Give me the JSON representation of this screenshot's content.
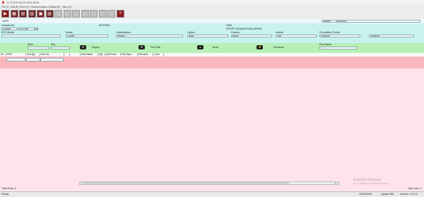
{
  "window": {
    "title": "A 'DSGR.MOA.BEN.BOB"
  },
  "menu": [
    "File (F)",
    "Edit (E)",
    "View (V)",
    "Communication (C)",
    "Data (D)",
    "Help (H)"
  ],
  "toolbar": {
    "buttons": [
      {
        "name": "exit-button",
        "glyph": "▶",
        "color": "#8b1a1a",
        "disabled": false
      },
      {
        "name": "open-button",
        "glyph": "▦",
        "color": "#7a2222",
        "disabled": false
      },
      {
        "name": "catalog-button",
        "glyph": "▤",
        "color": "#6b1f1f",
        "disabled": false
      },
      {
        "name": "print-button",
        "glyph": "▥",
        "color": "#702020",
        "disabled": false
      },
      {
        "name": "search-button",
        "glyph": "▣",
        "color": "#7b2323",
        "disabled": false
      },
      {
        "name": "list-button",
        "glyph": "▧",
        "color": "#6e1e1e",
        "disabled": false
      },
      {
        "name": "tool7-button",
        "glyph": "▢",
        "color": "#bdbdbd",
        "disabled": true
      },
      {
        "name": "tool8-button",
        "glyph": "▢",
        "color": "#bdbdbd",
        "disabled": true
      },
      {
        "name": "tool9-button",
        "glyph": "▢",
        "color": "#bdbdbd",
        "disabled": true
      },
      {
        "name": "tool10-button",
        "glyph": "▢",
        "color": "#bdbdbd",
        "disabled": true
      },
      {
        "name": "tool11-button",
        "glyph": "▢",
        "color": "#bdbdbd",
        "disabled": true
      },
      {
        "name": "tool12-button",
        "glyph": "▢",
        "color": "#bdbdbd",
        "disabled": true
      },
      {
        "name": "tool13-button",
        "glyph": "▢",
        "color": "#bdbdbd",
        "disabled": true
      },
      {
        "name": "help-button",
        "glyph": "?",
        "color": "#8b1a1a",
        "disabled": false
      }
    ]
  },
  "tabline": {
    "left": "CATS",
    "region": "JAPAN",
    "date": "2025/01/17"
  },
  "vehicle": {
    "chassis_label": "Chassis No",
    "chassis_prefix": "Z14AW",
    "chassis_value": "EZX 900",
    "model_name": "AIRTREK",
    "year": "2400",
    "description": "SPORT GEAR(HPW4D),SEPAT",
    "epc_label": "EPC Model",
    "epc_value": "",
    "model_label": "Model",
    "model_value": "CU4W",
    "class_label": "Classification",
    "class_value": "XRME2",
    "option_label": "Option",
    "option_value": "SW8",
    "exterior_label": "Exterior",
    "exterior_value": "A42A",
    "interior_label": "Interior",
    "interior_value": "14D",
    "period_label": "Production Period",
    "period_from": "2003032",
    "period_sep": "-",
    "period_to": "2003032"
  },
  "groups": {
    "main_label": "Main",
    "sub_label": "Sub",
    "engine": "Engine",
    "pwrtrain": "PwrTrain",
    "body": "Body",
    "electrical": "Electrical",
    "partname_label": "Part Name"
  },
  "table": {
    "columns": [
      "No",
      "PNC",
      "Ord Qty",
      "Part No",
      "",
      "",
      "Part Name",
      "Qty",
      "Unit Price",
      "Part Spec",
      "Remarks",
      "Color"
    ]
  },
  "footer": {
    "total_price": "Total Price: 0",
    "total_line": "Total Line: 0",
    "watermark_1": "Activate Windows",
    "watermark_2": "Go to Settings to activate Windows.",
    "status": "Ready",
    "date": "2025/02/09",
    "update": "Update NM",
    "version": "Version: 1.0.2.0"
  }
}
